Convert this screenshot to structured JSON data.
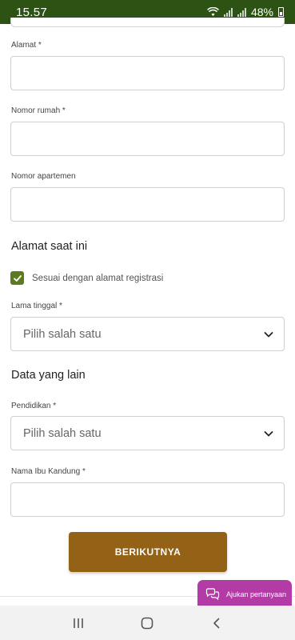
{
  "status_bar": {
    "time": "15.57",
    "battery": "48%"
  },
  "form": {
    "alamat_label": "Alamat *",
    "nomor_rumah_label": "Nomor rumah *",
    "nomor_apartemen_label": "Nomor apartemen",
    "section_current_address": "Alamat saat ini",
    "same_address_checkbox_label": "Sesuai dengan alamat registrasi",
    "same_address_checked": true,
    "lama_tinggal_label": "Lama tinggal *",
    "lama_tinggal_value": "Pilih salah satu",
    "section_other_data": "Data yang lain",
    "pendidikan_label": "Pendidikan *",
    "pendidikan_value": "Pilih salah satu",
    "nama_ibu_label": "Nama Ibu Kandung *"
  },
  "buttons": {
    "next_label": "BERIKUTNYA",
    "help_label": "Ajukan pertanyaan"
  },
  "colors": {
    "status_bar": "#2c5214",
    "checkbox": "#5b7a22",
    "primary_button": "#946216",
    "help_button": "#b23ba5"
  },
  "icons": {
    "dropdown": "chevron-down-icon",
    "checkbox": "checkmark-icon",
    "help": "chat-bubbles-icon",
    "nav_recent": "recent-apps-icon",
    "nav_home": "home-icon",
    "nav_back": "back-icon"
  }
}
